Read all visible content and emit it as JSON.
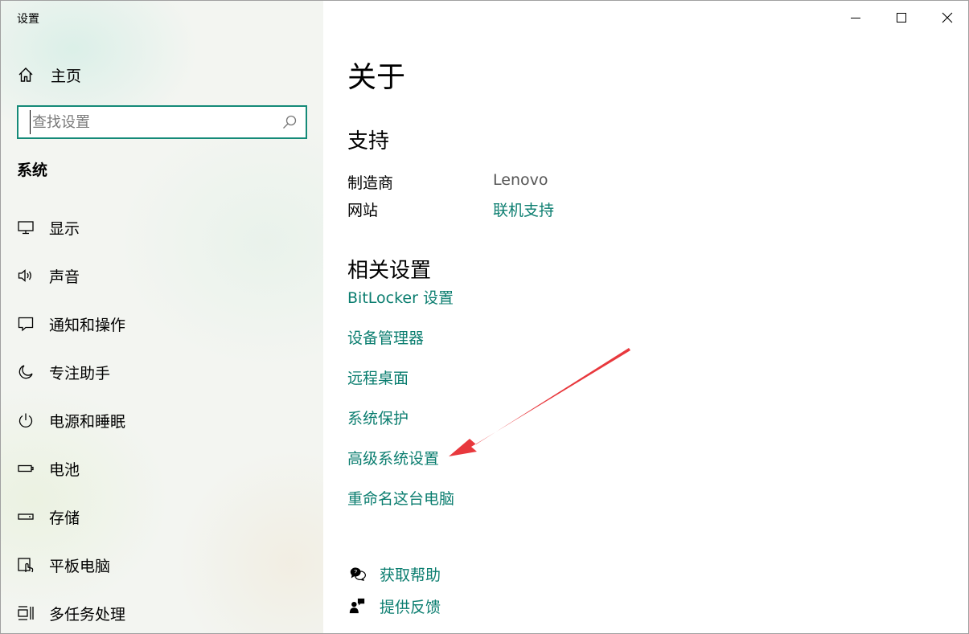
{
  "window": {
    "title": "设置"
  },
  "sidebar": {
    "home_label": "主页",
    "search_placeholder": "查找设置",
    "section_title": "系统",
    "items": [
      {
        "label": "显示",
        "icon": "display-icon"
      },
      {
        "label": "声音",
        "icon": "speaker-icon"
      },
      {
        "label": "通知和操作",
        "icon": "notification-icon"
      },
      {
        "label": "专注助手",
        "icon": "moon-icon"
      },
      {
        "label": "电源和睡眠",
        "icon": "power-icon"
      },
      {
        "label": "电池",
        "icon": "battery-icon"
      },
      {
        "label": "存储",
        "icon": "storage-icon"
      },
      {
        "label": "平板电脑",
        "icon": "tablet-icon"
      },
      {
        "label": "多任务处理",
        "icon": "multitask-icon"
      }
    ]
  },
  "main": {
    "title": "关于",
    "support": {
      "heading": "支持",
      "rows": [
        {
          "key": "制造商",
          "value": "Lenovo"
        },
        {
          "key": "网站",
          "value": "联机支持"
        }
      ]
    },
    "related": {
      "heading": "相关设置",
      "links": [
        "BitLocker 设置",
        "设备管理器",
        "远程桌面",
        "系统保护",
        "高级系统设置",
        "重命名这台电脑"
      ]
    },
    "help": {
      "get_help": "获取帮助",
      "feedback": "提供反馈"
    }
  },
  "colors": {
    "accent": "#0a7d6f",
    "search_border": "#148a78",
    "annotation_arrow": "#e8383d"
  }
}
